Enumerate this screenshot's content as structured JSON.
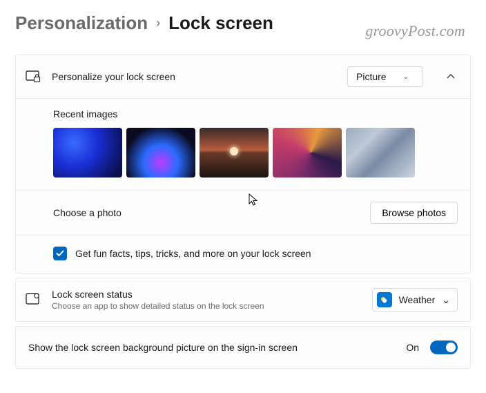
{
  "breadcrumb": {
    "parent": "Personalization",
    "current": "Lock screen"
  },
  "watermark": "groovyPost.com",
  "personalize": {
    "title": "Personalize your lock screen",
    "dropdown_value": "Picture",
    "recent_label": "Recent images",
    "choose_label": "Choose a photo",
    "browse_button": "Browse photos",
    "fun_facts_label": "Get fun facts, tips, tricks, and more on your lock screen"
  },
  "status": {
    "title": "Lock screen status",
    "subtitle": "Choose an app to show detailed status on the lock screen",
    "dropdown_value": "Weather"
  },
  "signin": {
    "label": "Show the lock screen background picture on the sign-in screen",
    "state": "On"
  }
}
